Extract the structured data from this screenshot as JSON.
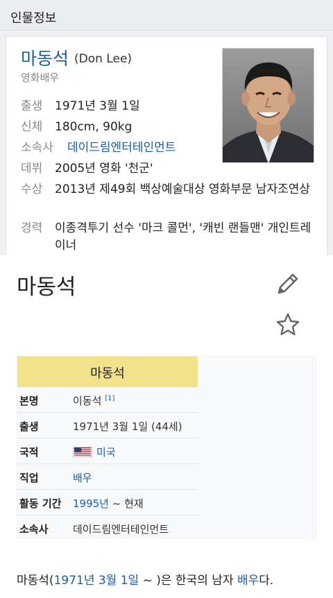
{
  "panel": {
    "header": "인물정보",
    "name_ko": "마동석",
    "name_en": "(Don Lee)",
    "subtitle": "영화배우",
    "facts": [
      {
        "label": "출생",
        "value": "1971년 3월 1일"
      },
      {
        "label": "신체",
        "value": "180cm, 90kg"
      },
      {
        "label": "소속사",
        "value": "데이드림엔터테인먼트"
      },
      {
        "label": "데뷔",
        "value": "2005년 영화 '천군'"
      },
      {
        "label": "수상",
        "value": "2013년 제49회 백상예술대상 영화부문 남자조연상"
      },
      {
        "label": "경력",
        "value": "이종격투기 선수 '마크 콜먼', '캐빈 랜들맨' 개인트레이너"
      }
    ]
  },
  "article": {
    "title": "마동석",
    "infobox": {
      "heading": "마동석",
      "rows": [
        {
          "label": "본명",
          "value": "이동석",
          "note": "[1]"
        },
        {
          "label": "출생",
          "value": "1971년 3월 1일 (44세)"
        },
        {
          "label": "국적",
          "value": "미국",
          "flag": "us-flag"
        },
        {
          "label": "직업",
          "value": "배우"
        },
        {
          "label": "활동 기간",
          "value_link": "1995년",
          "value_rest": " ~ 현재"
        },
        {
          "label": "소속사",
          "value": "데이드림엔터테인먼트"
        }
      ]
    },
    "lead": {
      "subject": "마동석",
      "open": "(",
      "date": "1971년 3월 1일",
      "close": " ~ )은 한국의 남자 ",
      "job": "배우",
      "end": "다."
    }
  },
  "colors": {
    "link": "#1a5da3",
    "infobox_header": "#f2e28a",
    "panel_background": "#eef0f4"
  }
}
